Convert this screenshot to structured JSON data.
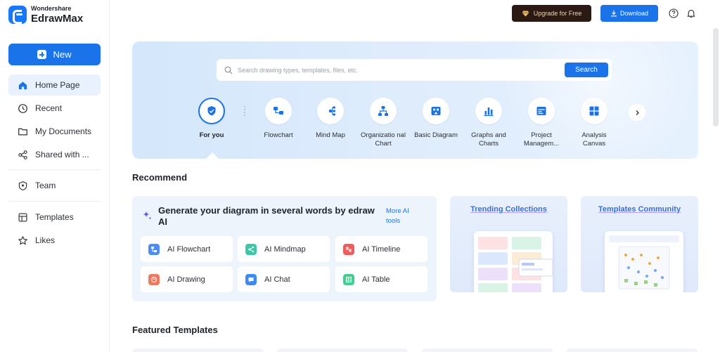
{
  "brand": {
    "top": "Wondershare",
    "name": "EdrawMax"
  },
  "sidebar": {
    "new_label": "New",
    "items": [
      {
        "label": "Home Page",
        "icon": "home-icon"
      },
      {
        "label": "Recent",
        "icon": "clock-icon"
      },
      {
        "label": "My Documents",
        "icon": "folder-icon"
      },
      {
        "label": "Shared with ...",
        "icon": "share-icon"
      },
      {
        "label": "Team",
        "icon": "team-icon"
      },
      {
        "label": "Templates",
        "icon": "template-icon"
      },
      {
        "label": "Likes",
        "icon": "star-icon"
      }
    ]
  },
  "topbar": {
    "upgrade_label": "Upgrade for Free",
    "download_label": "Download"
  },
  "search": {
    "placeholder": "Search drawing types, templates, files, etc.",
    "button_label": "Search"
  },
  "categories": [
    {
      "label": "For you",
      "icon": "for-you-icon",
      "active": true
    },
    {
      "label": "Flowchart",
      "icon": "flowchart-icon"
    },
    {
      "label": "Mind Map",
      "icon": "mind-map-icon"
    },
    {
      "label": "Organizatio nal Chart",
      "icon": "org-chart-icon"
    },
    {
      "label": "Basic Diagram",
      "icon": "basic-diagram-icon"
    },
    {
      "label": "Graphs and Charts",
      "icon": "graphs-icon"
    },
    {
      "label": "Project Managem...",
      "icon": "project-icon"
    },
    {
      "label": "Analysis Canvas",
      "icon": "analysis-canvas-icon"
    }
  ],
  "recommend": {
    "title": "Recommend",
    "ai_card": {
      "title": "Generate your diagram in several words by edraw AI",
      "more_label": "More AI tools",
      "items": [
        {
          "label": "AI Flowchart",
          "color": "#4a8df5"
        },
        {
          "label": "AI Mindmap",
          "color": "#3cc8a6"
        },
        {
          "label": "AI Timeline",
          "color": "#f05c5c"
        },
        {
          "label": "AI Drawing",
          "color": "#f2785c"
        },
        {
          "label": "AI Chat",
          "color": "#3d8af7"
        },
        {
          "label": "AI Table",
          "color": "#3fcf8e"
        }
      ]
    },
    "promos": [
      {
        "title": "Trending Collections"
      },
      {
        "title": "Templates Community"
      }
    ]
  },
  "featured": {
    "title": "Featured Templates"
  },
  "colors": {
    "accent": "#1a73e8",
    "upgrade_bg": "#2b1a14",
    "upgrade_text": "#f3d5a8"
  }
}
